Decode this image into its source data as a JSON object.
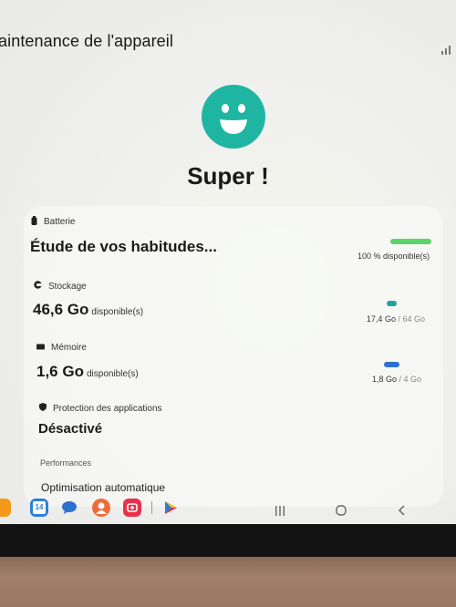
{
  "header": {
    "title": "aintenance de l'appareil"
  },
  "hero": {
    "status_icon": "smiley-face-icon",
    "status_text": "Super !",
    "accent": "#1fb5a3"
  },
  "battery": {
    "label": "Batterie",
    "status": "Étude de vos habitudes...",
    "available": "100 % disponible(s)",
    "level_fraction": 1.0,
    "color": "#5bd36b"
  },
  "storage": {
    "label": "Stockage",
    "value": "46,6 Go",
    "unit": "disponible(s)",
    "used": "17,4 Go",
    "total": "/ 64 Go",
    "used_fraction": 0.27,
    "color": "#1fa39a"
  },
  "memory": {
    "label": "Mémoire",
    "value": "1,6 Go",
    "unit": "disponible(s)",
    "used": "1,8 Go",
    "total": "/ 4 Go",
    "used_fraction": 0.45,
    "color": "#2f6fd1"
  },
  "app_protection": {
    "label": "Protection des applications",
    "value": "Désactivé"
  },
  "performance": {
    "label": "Performances",
    "item": "Optimisation automatique"
  },
  "dock": {
    "calendar_day": "14",
    "apps": [
      "orange-app-icon",
      "calendar-icon",
      "messages-icon",
      "contacts-icon",
      "screen-recorder-icon",
      "play-store-icon"
    ]
  },
  "nav": {
    "recents": "recents-icon",
    "home": "home-icon",
    "back": "back-icon"
  }
}
